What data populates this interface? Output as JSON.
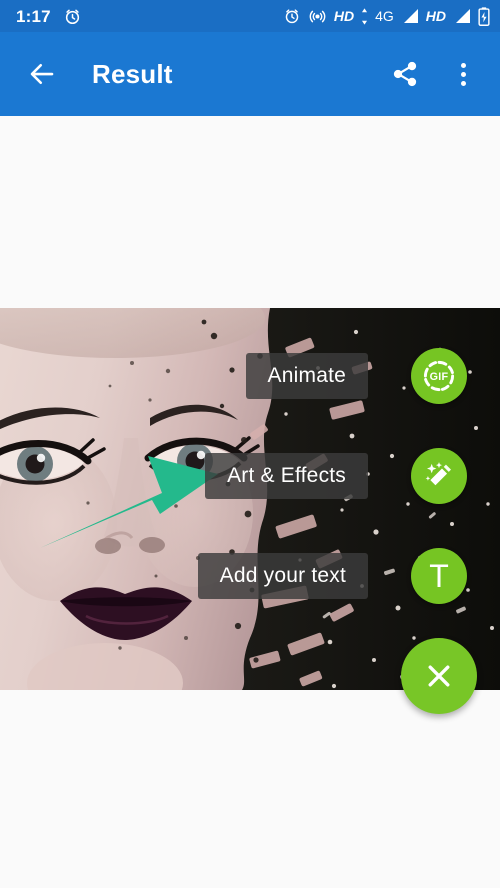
{
  "status_bar": {
    "time": "1:17",
    "alarm_icon": "alarm-clock-icon",
    "right_icons": [
      {
        "name": "alarm-clock-icon",
        "type": "icon"
      },
      {
        "name": "hotspot-icon",
        "type": "icon"
      },
      {
        "name": "hd-volte-label",
        "type": "text",
        "label": "HD"
      },
      {
        "name": "data-transfer-icon",
        "type": "icon"
      },
      {
        "name": "network-type-label",
        "type": "text",
        "label": "4G"
      },
      {
        "name": "signal-bars-sim1-icon",
        "type": "icon"
      },
      {
        "name": "hd-volte-label-2",
        "type": "text",
        "label": "HD"
      },
      {
        "name": "signal-bars-sim2-icon",
        "type": "icon"
      },
      {
        "name": "battery-charging-icon",
        "type": "icon"
      }
    ],
    "background_color": "#1a6ec4"
  },
  "app_bar": {
    "title": "Result",
    "back_icon": "back-arrow-icon",
    "share_icon": "share-icon",
    "overflow_icon": "more-vertical-icon",
    "background_color": "#1b78d2",
    "text_color": "#ffffff"
  },
  "photo": {
    "description": "woman portrait with dispersion shatter effect",
    "background_color": "#100f0c"
  },
  "fab_menu": {
    "accent_color": "#76c523",
    "label_background": "rgba(60,60,60,0.82)",
    "items": [
      {
        "label": "Animate",
        "icon": "gif-icon",
        "name": "fab-animate"
      },
      {
        "label": "Art & Effects",
        "icon": "magic-wand-icon",
        "name": "fab-art-effects"
      },
      {
        "label": "Add your text",
        "icon": "text-t-icon",
        "name": "fab-add-text"
      }
    ],
    "close": {
      "icon": "close-x-icon",
      "name": "fab-close-button"
    }
  },
  "annotation": {
    "arrow_color": "#24b98c",
    "points_to": "fab-art-effects"
  },
  "page_background": "#FAFAFA"
}
